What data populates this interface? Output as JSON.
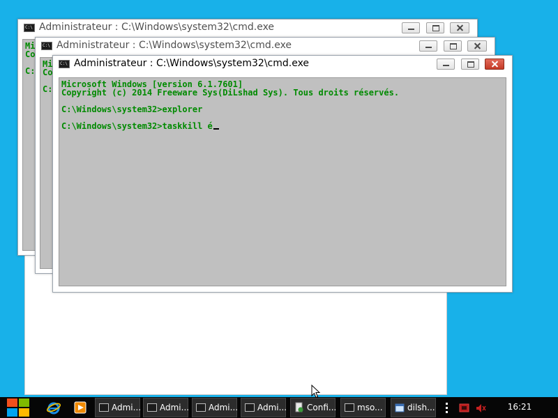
{
  "windows": [
    {
      "title": "Administrateur : C:\\Windows\\system32\\cmd.exe",
      "icon": "cmd-icon",
      "console_lines": "Mi\nCo\n\nC:"
    },
    {
      "title": "Administrateur : C:\\Windows\\system32\\cmd.exe",
      "icon": "cmd-icon",
      "console_lines": "Mi\nCo\n\nC:"
    },
    {
      "title": "Administrateur : C:\\Windows\\system32\\cmd.exe",
      "icon": "cmd-icon",
      "console_lines": "Microsoft Windows [version 6.1.7601]\nCopyright (c) 2014 Freeware Sys(DiLshad Sys). Tous droits réservés.\n\nC:\\Windows\\system32>explorer\n\nC:\\Windows\\system32>taskkill é"
    }
  ],
  "cmd_icon_text": "C:\\",
  "taskbar": {
    "items": [
      {
        "label": "Admi...",
        "icon": "cmd-icon"
      },
      {
        "label": "Admi...",
        "icon": "cmd-icon"
      },
      {
        "label": "Admi...",
        "icon": "cmd-icon"
      },
      {
        "label": "Admi...",
        "icon": "cmd-icon"
      },
      {
        "label": "Confi...",
        "icon": "msconfig-icon"
      },
      {
        "label": "mso...",
        "icon": "cmd-icon"
      },
      {
        "label": "dilsh...",
        "icon": "window-app-icon"
      }
    ],
    "clock": "16:21"
  },
  "colors": {
    "desktop": "#18b1e9",
    "console_bg": "#c0c0c0",
    "console_text": "#008a00",
    "start_red": "#f24f1c",
    "start_green": "#7fba00",
    "start_blue": "#00a4ef",
    "start_yellow": "#ffb900"
  }
}
